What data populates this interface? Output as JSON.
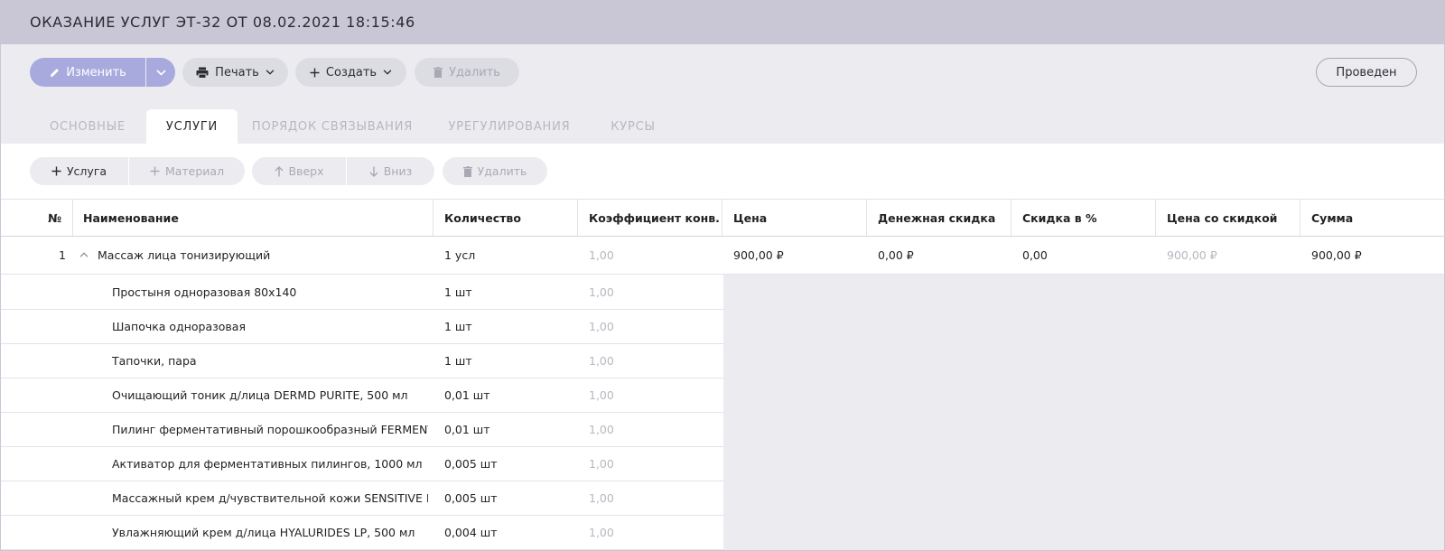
{
  "document_title": "ОКАЗАНИЕ УСЛУГ ЭТ-32 ОТ 08.02.2021 18:15:46",
  "toolbar": {
    "edit_label": "Изменить",
    "print_label": "Печать",
    "create_label": "Создать",
    "delete_label": "Удалить",
    "status_label": "Проведен"
  },
  "tabs": [
    {
      "label": "ОСНОВНЫЕ",
      "active": false
    },
    {
      "label": "УСЛУГИ",
      "active": true
    },
    {
      "label": "ПОРЯДОК СВЯЗЫВАНИЯ",
      "active": false
    },
    {
      "label": "УРЕГУЛИРОВАНИЯ",
      "active": false
    },
    {
      "label": "КУРСЫ",
      "active": false
    }
  ],
  "subtoolbar": {
    "service_label": "Услуга",
    "material_label": "Материал",
    "up_label": "Вверх",
    "down_label": "Вниз",
    "delete_label": "Удалить"
  },
  "table": {
    "columns": [
      "№",
      "Наименование",
      "Количество",
      "Коэффициент конв...",
      "Цена",
      "Денежная скидка",
      "Скидка в %",
      "Цена со скидкой",
      "Сумма"
    ],
    "service_row": {
      "num": "1",
      "name": "Массаж лица тонизирующий",
      "qty": "1 усл",
      "coef": "1,00",
      "price": "900,00 ₽",
      "money_discount": "0,00 ₽",
      "percent_discount": "0,00",
      "discounted_price": "900,00 ₽",
      "sum": "900,00 ₽"
    },
    "material_rows": [
      {
        "name": "Простыня одноразовая 80х140",
        "qty": "1 шт",
        "coef": "1,00"
      },
      {
        "name": "Шапочка одноразовая",
        "qty": "1 шт",
        "coef": "1,00"
      },
      {
        "name": "Тапочки, пара",
        "qty": "1 шт",
        "coef": "1,00"
      },
      {
        "name": "Очищающий тоник д/лица DERMD PURITE, 500 мл",
        "qty": "0,01 шт",
        "coef": "1,00"
      },
      {
        "name": "Пилинг ферментативный порошкообразный FERMENT...",
        "qty": "0,01 шт",
        "coef": "1,00"
      },
      {
        "name": "Активатор для ферментативных пилингов, 1000 мл",
        "qty": "0,005 шт",
        "coef": "1,00"
      },
      {
        "name": "Массажный крем д/чувствительной кожи SENSITIVE M...",
        "qty": "0,005 шт",
        "coef": "1,00"
      },
      {
        "name": "Увлажняющий крем д/лица HYALURIDES LP, 500 мл",
        "qty": "0,004 шт",
        "coef": "1,00"
      }
    ]
  },
  "colors": {
    "title_bar": "#c9c6d6",
    "toolbar_bg": "#ececf0",
    "edit_button": "#a8aadd",
    "muted_text": "#b7b7c0"
  }
}
